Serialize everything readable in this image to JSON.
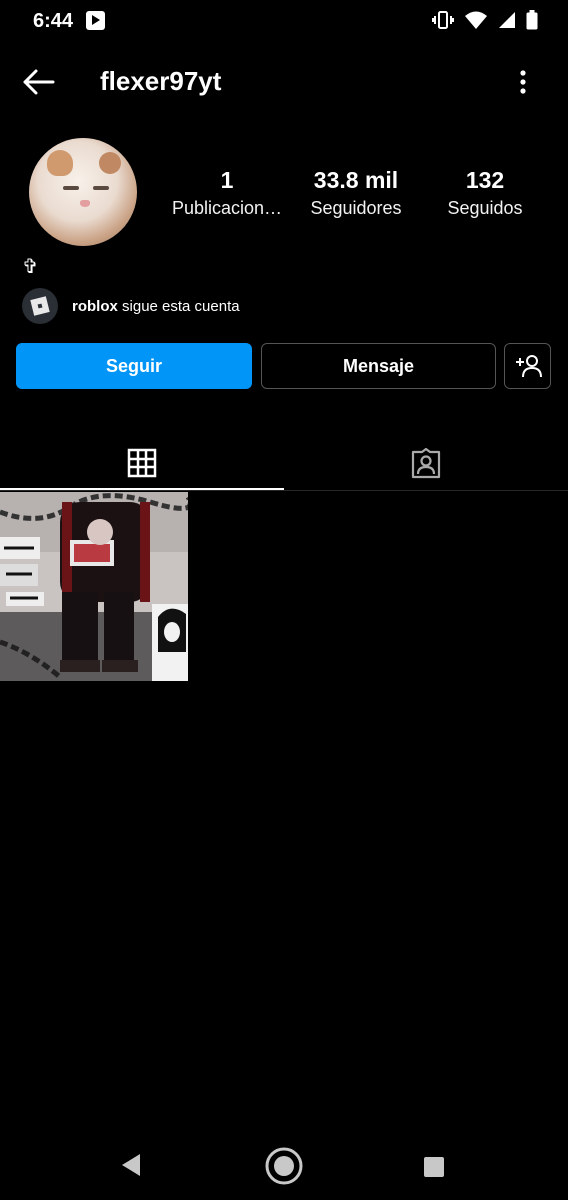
{
  "status_bar": {
    "time": "6:44",
    "icons": [
      "app-notification-icon",
      "vibrate-icon",
      "wifi-icon",
      "signal-icon",
      "battery-icon"
    ]
  },
  "header": {
    "username": "flexer97yt",
    "back_icon": "arrow-left-icon",
    "more_icon": "more-vertical-icon"
  },
  "profile": {
    "stats": [
      {
        "value": "1",
        "label": "Publicacion…"
      },
      {
        "value": "33.8 mil",
        "label": "Seguidores"
      },
      {
        "value": "132",
        "label": "Seguidos"
      }
    ],
    "bio": "✞",
    "followed_by": {
      "name": "roblox",
      "text": "sigue esta cuenta"
    }
  },
  "actions": {
    "follow_label": "Seguir",
    "message_label": "Mensaje",
    "add_user_icon": "add-person-icon"
  },
  "tabs": [
    {
      "icon": "grid-icon",
      "active": true
    },
    {
      "icon": "tagged-person-icon",
      "active": false
    }
  ],
  "posts_count_shown": 1,
  "colors": {
    "background": "#000000",
    "accent": "#0095f6",
    "border": "#555555"
  }
}
